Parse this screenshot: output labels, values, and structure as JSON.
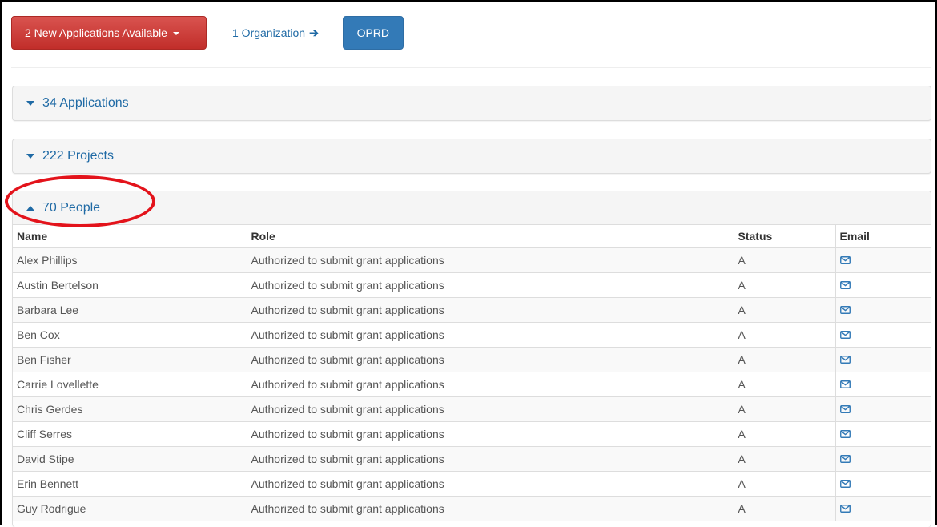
{
  "toolbar": {
    "new_apps_label": "2 New Applications Available",
    "org_link_label": "1 Organization",
    "org_button_label": "OPRD"
  },
  "panels": {
    "applications": "34 Applications",
    "projects": "222 Projects",
    "people": "70 People"
  },
  "people_table": {
    "headers": {
      "name": "Name",
      "role": "Role",
      "status": "Status",
      "email": "Email"
    },
    "rows": [
      {
        "name": "Alex Phillips",
        "role": "Authorized to submit grant applications",
        "status": "A"
      },
      {
        "name": "Austin Bertelson",
        "role": "Authorized to submit grant applications",
        "status": "A"
      },
      {
        "name": "Barbara Lee",
        "role": "Authorized to submit grant applications",
        "status": "A"
      },
      {
        "name": "Ben Cox",
        "role": "Authorized to submit grant applications",
        "status": "A"
      },
      {
        "name": "Ben Fisher",
        "role": "Authorized to submit grant applications",
        "status": "A"
      },
      {
        "name": "Carrie Lovellette",
        "role": "Authorized to submit grant applications",
        "status": "A"
      },
      {
        "name": "Chris Gerdes",
        "role": "Authorized to submit grant applications",
        "status": "A"
      },
      {
        "name": "Cliff Serres",
        "role": "Authorized to submit grant applications",
        "status": "A"
      },
      {
        "name": "David Stipe",
        "role": "Authorized to submit grant applications",
        "status": "A"
      },
      {
        "name": "Erin Bennett",
        "role": "Authorized to submit grant applications",
        "status": "A"
      },
      {
        "name": "Guy Rodrigue",
        "role": "Authorized to submit grant applications",
        "status": "A"
      }
    ]
  },
  "icons": {
    "org_arrow": "arrow-right-icon",
    "email": "envelope-icon",
    "panel_collapsed": "triangle-down-icon",
    "panel_expanded": "triangle-up-icon"
  },
  "colors": {
    "danger": "#d9534f",
    "primary": "#337ab7",
    "link": "#1f6aa5",
    "annotation": "#e3131b"
  }
}
